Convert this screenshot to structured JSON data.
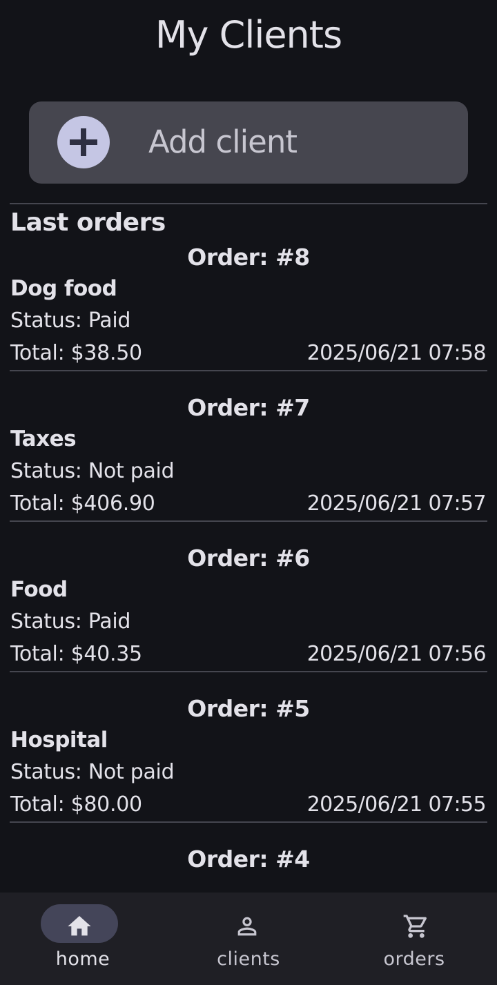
{
  "header": {
    "title": "My Clients"
  },
  "add_client": {
    "label": "Add client",
    "icon": "plus-icon"
  },
  "last_orders": {
    "title": "Last orders",
    "orders": [
      {
        "number": "Order: #8",
        "name": "Dog food",
        "status": "Status: Paid",
        "total": "Total: $38.50",
        "date": "2025/06/21 07:58"
      },
      {
        "number": "Order: #7",
        "name": "Taxes",
        "status": "Status: Not paid",
        "total": "Total: $406.90",
        "date": "2025/06/21 07:57"
      },
      {
        "number": "Order: #6",
        "name": "Food",
        "status": "Status: Paid",
        "total": "Total: $40.35",
        "date": "2025/06/21 07:56"
      },
      {
        "number": "Order: #5",
        "name": "Hospital",
        "status": "Status: Not paid",
        "total": "Total: $80.00",
        "date": "2025/06/21 07:55"
      },
      {
        "number": "Order: #4",
        "name": "",
        "status": "",
        "total": "",
        "date": ""
      }
    ]
  },
  "nav": {
    "active": "home",
    "items": [
      {
        "label": "home",
        "icon": "home-icon"
      },
      {
        "label": "clients",
        "icon": "person-icon"
      },
      {
        "label": "orders",
        "icon": "cart-icon"
      }
    ]
  },
  "colors": {
    "background": "#121318",
    "surface": "#46464f",
    "accent": "#c5c6e4",
    "nav_background": "#1f1f25",
    "nav_active_pill": "#444559"
  }
}
